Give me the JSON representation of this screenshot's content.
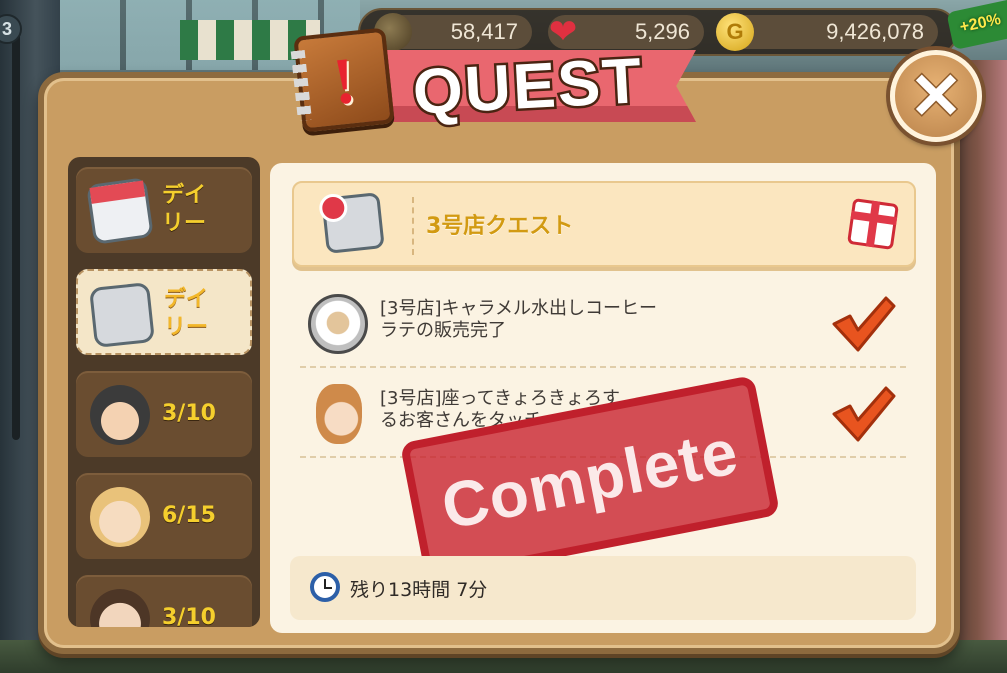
{
  "hud": {
    "level_badge": "3",
    "currency_1": "58,417",
    "currency_2": "5,296",
    "currency_3": "9,426,078",
    "gold_symbol": "G",
    "heart_symbol": "❤",
    "bonus": "+20%"
  },
  "dialog": {
    "title": "QUEST",
    "close_symbol": "✕"
  },
  "tabs": [
    {
      "label": "デイ\nリー",
      "icon": "daily-calendar-icon",
      "active": false
    },
    {
      "label": "デイ\nリー",
      "icon": "daily-shop-icon",
      "active": true
    },
    {
      "label": "3/10",
      "icon": "old-man-face-icon",
      "active": false
    },
    {
      "label": "6/15",
      "icon": "blond-man-face-icon",
      "active": false
    },
    {
      "label": "3/10",
      "icon": "dark-hair-man-face-icon",
      "active": false
    }
  ],
  "quest": {
    "header_title": "3号店クエスト",
    "tasks": [
      {
        "text": "[3号店]キャラメル水出しコーヒー\nラテの販売完了",
        "icon": "coffee-cup-icon",
        "done": true
      },
      {
        "text": "[3号店]座ってきょろきょろす\nるお客さんをタッチ",
        "icon": "girl-face-icon",
        "done": true
      }
    ],
    "stamp": "Complete",
    "timer": "残り13時間 7分"
  },
  "colors": {
    "dialog_bg": "#c99d62",
    "ribbon": "#e9676f",
    "tab_label": "#f5cf2d",
    "stamp": "#c0202c",
    "check": "#e8541f"
  }
}
